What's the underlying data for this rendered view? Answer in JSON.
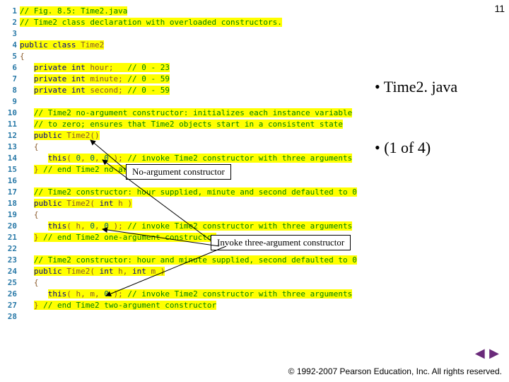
{
  "slide_number": "11",
  "bullets": {
    "b1": "• Time2. java",
    "b2": "• (1 of 4)"
  },
  "callouts": {
    "c1": "No-argument constructor",
    "c2": "Invoke three-argument constructor"
  },
  "nav": {
    "prev": "◀",
    "next": "▶"
  },
  "footer": "© 1992-2007 Pearson Education, Inc.  All rights reserved.",
  "code": {
    "l1": {
      "n": "1",
      "pre": "",
      "seg": [
        {
          "t": "// Fig. 8.5: Time2.java",
          "cls": "c-green hl"
        }
      ]
    },
    "l2": {
      "n": "2",
      "pre": "",
      "seg": [
        {
          "t": "// Time2 class declaration with overloaded constructors.",
          "cls": "c-green hl"
        }
      ]
    },
    "l3": {
      "n": "3",
      "pre": "",
      "seg": [
        {
          "t": "",
          "cls": ""
        }
      ]
    },
    "l4": {
      "n": "4",
      "pre": "",
      "seg": [
        {
          "t": "public class ",
          "cls": "c-navy hl"
        },
        {
          "t": "Time2",
          "cls": "c-brown hl"
        }
      ]
    },
    "l5": {
      "n": "5",
      "pre": "",
      "seg": [
        {
          "t": "{",
          "cls": "c-brown"
        }
      ]
    },
    "l6": {
      "n": "6",
      "pre": "   ",
      "seg": [
        {
          "t": "private int ",
          "cls": "c-navy hl"
        },
        {
          "t": "hour;   ",
          "cls": "c-brown hl"
        },
        {
          "t": "// 0 - 23",
          "cls": "c-green hl"
        }
      ]
    },
    "l7": {
      "n": "7",
      "pre": "   ",
      "seg": [
        {
          "t": "private int ",
          "cls": "c-navy hl"
        },
        {
          "t": "minute; ",
          "cls": "c-brown hl"
        },
        {
          "t": "// 0 - 59",
          "cls": "c-green hl"
        }
      ]
    },
    "l8": {
      "n": "8",
      "pre": "   ",
      "seg": [
        {
          "t": "private int ",
          "cls": "c-navy hl"
        },
        {
          "t": "second; ",
          "cls": "c-brown hl"
        },
        {
          "t": "// 0 - 59",
          "cls": "c-green hl"
        }
      ]
    },
    "l9": {
      "n": "9",
      "pre": "",
      "seg": [
        {
          "t": "",
          "cls": ""
        }
      ]
    },
    "l10": {
      "n": "10",
      "pre": "   ",
      "seg": [
        {
          "t": "// Time2 no-argument constructor: initializes each instance variable",
          "cls": "c-green hl"
        }
      ]
    },
    "l11": {
      "n": "11",
      "pre": "   ",
      "seg": [
        {
          "t": "// to zero; ensures that Time2 objects start in a consistent state",
          "cls": "c-green hl"
        }
      ]
    },
    "l12": {
      "n": "12",
      "pre": "   ",
      "seg": [
        {
          "t": "public ",
          "cls": "c-navy hl"
        },
        {
          "t": "Time2()",
          "cls": "c-brown hl"
        }
      ]
    },
    "l13": {
      "n": "13",
      "pre": "   ",
      "seg": [
        {
          "t": "{",
          "cls": "c-brown"
        }
      ]
    },
    "l14": {
      "n": "14",
      "pre": "      ",
      "seg": [
        {
          "t": "this",
          "cls": "c-navy hl"
        },
        {
          "t": "( ",
          "cls": "c-brown hl"
        },
        {
          "t": "0",
          "cls": "c-teal hl"
        },
        {
          "t": ", ",
          "cls": "c-brown hl"
        },
        {
          "t": "0",
          "cls": "c-teal hl"
        },
        {
          "t": ", ",
          "cls": "c-brown hl"
        },
        {
          "t": "0",
          "cls": "c-teal hl"
        },
        {
          "t": " ); ",
          "cls": "c-brown hl"
        },
        {
          "t": "// invoke Time2 constructor with three arguments",
          "cls": "c-green hl"
        }
      ]
    },
    "l15": {
      "n": "15",
      "pre": "   ",
      "seg": [
        {
          "t": "} ",
          "cls": "c-brown hl"
        },
        {
          "t": "// end Time2 no-argument constructor",
          "cls": "c-green hl"
        }
      ]
    },
    "l16": {
      "n": "16",
      "pre": "",
      "seg": [
        {
          "t": "",
          "cls": ""
        }
      ]
    },
    "l17": {
      "n": "17",
      "pre": "   ",
      "seg": [
        {
          "t": "// Time2 constructor: hour supplied, minute and second defaulted to 0",
          "cls": "c-green hl"
        }
      ]
    },
    "l18": {
      "n": "18",
      "pre": "   ",
      "seg": [
        {
          "t": "public ",
          "cls": "c-navy hl"
        },
        {
          "t": "Time2( ",
          "cls": "c-brown hl"
        },
        {
          "t": "int ",
          "cls": "c-navy hl"
        },
        {
          "t": "h )",
          "cls": "c-brown hl"
        }
      ]
    },
    "l19": {
      "n": "19",
      "pre": "   ",
      "seg": [
        {
          "t": "{",
          "cls": "c-brown"
        }
      ]
    },
    "l20": {
      "n": "20",
      "pre": "      ",
      "seg": [
        {
          "t": "this",
          "cls": "c-navy hl"
        },
        {
          "t": "( h, ",
          "cls": "c-brown hl"
        },
        {
          "t": "0",
          "cls": "c-teal hl"
        },
        {
          "t": ", ",
          "cls": "c-brown hl"
        },
        {
          "t": "0",
          "cls": "c-teal hl"
        },
        {
          "t": " ); ",
          "cls": "c-brown hl"
        },
        {
          "t": "// invoke Time2 constructor with three arguments",
          "cls": "c-green hl"
        }
      ]
    },
    "l21": {
      "n": "21",
      "pre": "   ",
      "seg": [
        {
          "t": "} ",
          "cls": "c-brown hl"
        },
        {
          "t": "// end Time2 one-argument constructor",
          "cls": "c-green hl"
        }
      ]
    },
    "l22": {
      "n": "22",
      "pre": "",
      "seg": [
        {
          "t": "",
          "cls": ""
        }
      ]
    },
    "l23": {
      "n": "23",
      "pre": "   ",
      "seg": [
        {
          "t": "// Time2 constructor: hour and minute supplied, second defaulted to 0",
          "cls": "c-green hl"
        }
      ]
    },
    "l24": {
      "n": "24",
      "pre": "   ",
      "seg": [
        {
          "t": "public ",
          "cls": "c-navy hl"
        },
        {
          "t": "Time2( ",
          "cls": "c-brown hl"
        },
        {
          "t": "int ",
          "cls": "c-navy hl"
        },
        {
          "t": "h, ",
          "cls": "c-brown hl"
        },
        {
          "t": "int ",
          "cls": "c-navy hl"
        },
        {
          "t": "m )",
          "cls": "c-brown hl"
        }
      ]
    },
    "l25": {
      "n": "25",
      "pre": "   ",
      "seg": [
        {
          "t": "{",
          "cls": "c-brown"
        }
      ]
    },
    "l26": {
      "n": "26",
      "pre": "      ",
      "seg": [
        {
          "t": "this",
          "cls": "c-navy hl"
        },
        {
          "t": "( h, m, ",
          "cls": "c-brown hl"
        },
        {
          "t": "0",
          "cls": "c-teal hl"
        },
        {
          "t": " ); ",
          "cls": "c-brown hl"
        },
        {
          "t": "// invoke Time2 constructor with three arguments",
          "cls": "c-green hl"
        }
      ]
    },
    "l27": {
      "n": "27",
      "pre": "   ",
      "seg": [
        {
          "t": "} ",
          "cls": "c-brown hl"
        },
        {
          "t": "// end Time2 two-argument constructor",
          "cls": "c-green hl"
        }
      ]
    },
    "l28": {
      "n": "28",
      "pre": "",
      "seg": [
        {
          "t": "",
          "cls": ""
        }
      ]
    }
  }
}
